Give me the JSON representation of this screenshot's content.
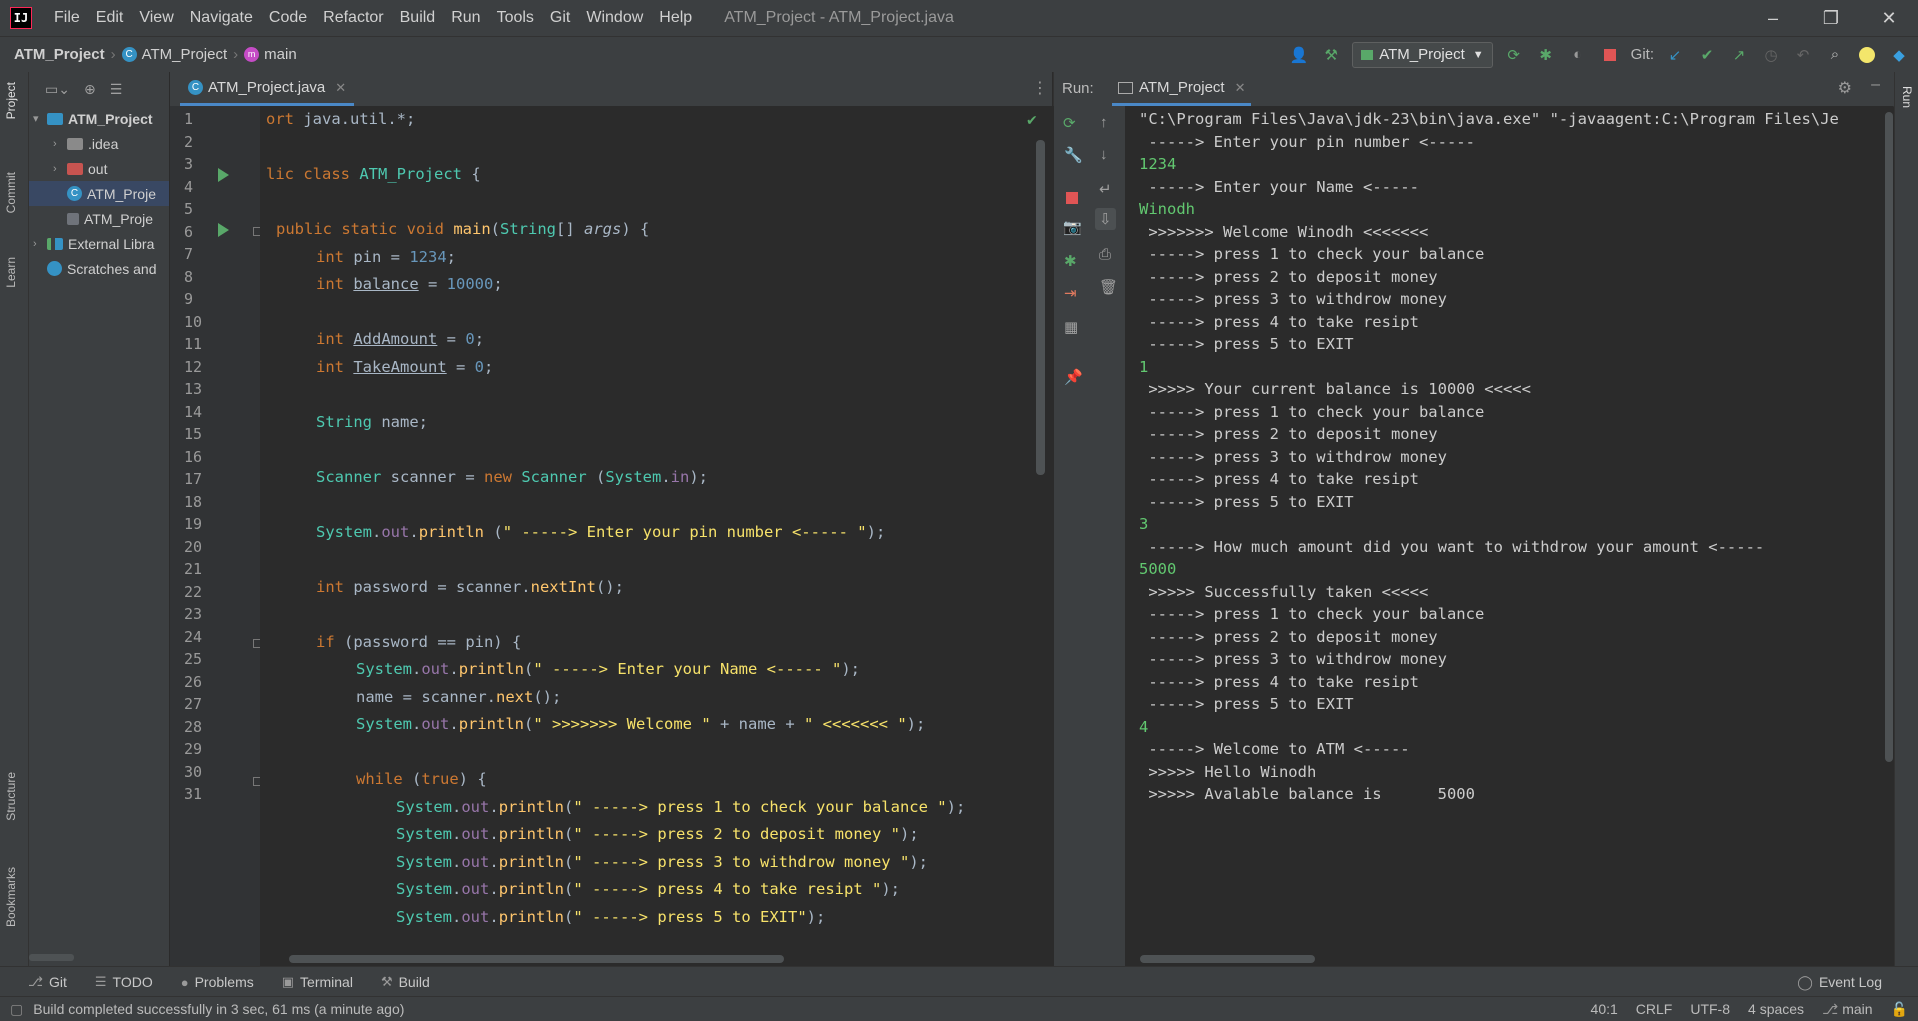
{
  "window": {
    "title": "ATM_Project - ATM_Project.java",
    "menu": [
      "File",
      "Edit",
      "View",
      "Navigate",
      "Code",
      "Refactor",
      "Build",
      "Run",
      "Tools",
      "Git",
      "Window",
      "Help"
    ],
    "controls": [
      "–",
      "❐",
      "✕"
    ]
  },
  "navbar": {
    "project": "ATM_Project",
    "file": "ATM_Project",
    "method": "main",
    "run_config": "ATM_Project",
    "git_label": "Git:"
  },
  "tool_windows": {
    "left": [
      "Project",
      "Commit",
      "Learn",
      "Structure",
      "Bookmarks"
    ],
    "right": [
      "Run"
    ]
  },
  "project_tree": [
    {
      "label": "ATM_Project",
      "arrow": "▾",
      "indent": 0,
      "icon": "folder-blue",
      "bold": true
    },
    {
      "label": ".idea",
      "arrow": "›",
      "indent": 1,
      "icon": "folder-gray"
    },
    {
      "label": "out",
      "arrow": "›",
      "indent": 1,
      "icon": "folder-red"
    },
    {
      "label": "ATM_Proje",
      "arrow": "",
      "indent": 1,
      "icon": "class",
      "selected": true
    },
    {
      "label": "ATM_Proje",
      "arrow": "",
      "indent": 1,
      "icon": "iml"
    },
    {
      "label": "External Libra",
      "arrow": "›",
      "indent": 0,
      "icon": "library"
    },
    {
      "label": "Scratches and",
      "arrow": "",
      "indent": 0,
      "icon": "scratch"
    }
  ],
  "editor": {
    "tab": "ATM_Project.java",
    "line_numbers": [
      "1",
      "2",
      "3",
      "4",
      "5",
      "6",
      "7",
      "8",
      "9",
      "10",
      "11",
      "12",
      "13",
      "14",
      "15",
      "16",
      "17",
      "18",
      "19",
      "20",
      "21",
      "22",
      "23",
      "24",
      "25",
      "26",
      "27",
      "28",
      "29",
      "30",
      "31"
    ]
  },
  "run_panel": {
    "label": "Run:",
    "tab": "ATM_Project",
    "output": [
      {
        "text": "\"C:\\Program Files\\Java\\jdk-23\\bin\\java.exe\" \"-javaagent:C:\\Program Files\\Je",
        "input": false
      },
      {
        "text": " -----> Enter your pin number <-----",
        "input": false
      },
      {
        "text": "1234",
        "input": true
      },
      {
        "text": " -----> Enter your Name <-----",
        "input": false
      },
      {
        "text": "Winodh",
        "input": true
      },
      {
        "text": " >>>>>>> Welcome Winodh <<<<<<<",
        "input": false
      },
      {
        "text": " -----> press 1 to check your balance",
        "input": false
      },
      {
        "text": " -----> press 2 to deposit money",
        "input": false
      },
      {
        "text": " -----> press 3 to withdrow money",
        "input": false
      },
      {
        "text": " -----> press 4 to take resipt",
        "input": false
      },
      {
        "text": " -----> press 5 to EXIT",
        "input": false
      },
      {
        "text": "1",
        "input": true
      },
      {
        "text": " >>>>> Your current balance is 10000 <<<<<",
        "input": false
      },
      {
        "text": " -----> press 1 to check your balance",
        "input": false
      },
      {
        "text": " -----> press 2 to deposit money",
        "input": false
      },
      {
        "text": " -----> press 3 to withdrow money",
        "input": false
      },
      {
        "text": " -----> press 4 to take resipt",
        "input": false
      },
      {
        "text": " -----> press 5 to EXIT",
        "input": false
      },
      {
        "text": "3",
        "input": true
      },
      {
        "text": " -----> How much amount did you want to withdrow your amount <-----",
        "input": false
      },
      {
        "text": "5000",
        "input": true
      },
      {
        "text": " >>>>> Successfully taken <<<<<",
        "input": false
      },
      {
        "text": " -----> press 1 to check your balance",
        "input": false
      },
      {
        "text": " -----> press 2 to deposit money",
        "input": false
      },
      {
        "text": " -----> press 3 to withdrow money",
        "input": false
      },
      {
        "text": " -----> press 4 to take resipt",
        "input": false
      },
      {
        "text": " -----> press 5 to EXIT",
        "input": false
      },
      {
        "text": "4",
        "input": true
      },
      {
        "text": " -----> Welcome to ATM <-----",
        "input": false
      },
      {
        "text": " >>>>> Hello Winodh",
        "input": false
      },
      {
        "text": " >>>>> Avalable balance is      5000",
        "input": false
      }
    ]
  },
  "bottom_tools": [
    {
      "label": "Git",
      "icon": "git-branch-icon",
      "glyph": "⎇"
    },
    {
      "label": "TODO",
      "icon": "list-icon",
      "glyph": "☰"
    },
    {
      "label": "Problems",
      "icon": "problems-icon",
      "glyph": "●"
    },
    {
      "label": "Terminal",
      "icon": "terminal-icon",
      "glyph": "▣"
    },
    {
      "label": "Build",
      "icon": "hammer-icon",
      "glyph": "⚒"
    }
  ],
  "event_log": "Event Log",
  "status": {
    "message": "Build completed successfully in 3 sec, 61 ms (a minute ago)",
    "position": "40:1",
    "line_sep": "CRLF",
    "encoding": "UTF-8",
    "indent": "4 spaces",
    "branch": "main"
  },
  "colors": {
    "background": "#2b2b2b",
    "panel": "#3c3f41",
    "keyword": "#cc7832",
    "string": "#f7e26a",
    "console_input": "#62c870",
    "run_green": "#59a869"
  }
}
